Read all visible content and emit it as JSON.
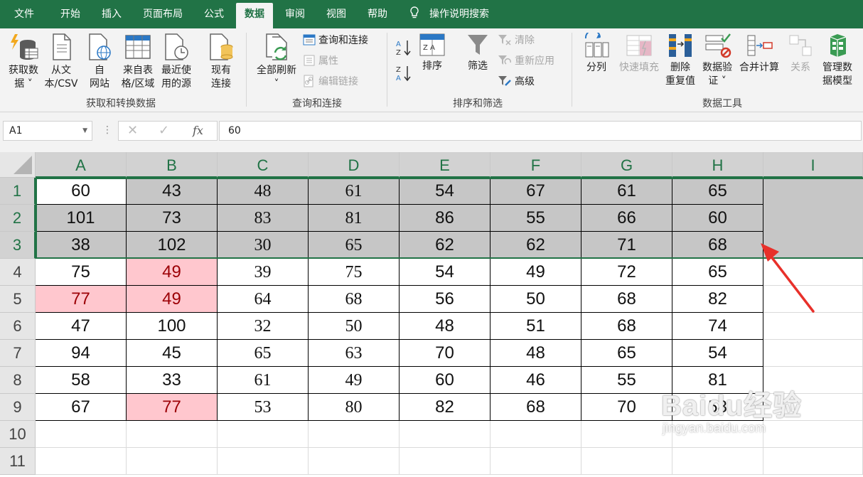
{
  "tabs": [
    {
      "label": "文件",
      "active": false
    },
    {
      "label": "开始",
      "active": false
    },
    {
      "label": "插入",
      "active": false
    },
    {
      "label": "页面布局",
      "active": false
    },
    {
      "label": "公式",
      "active": false
    },
    {
      "label": "数据",
      "active": true
    },
    {
      "label": "审阅",
      "active": false
    },
    {
      "label": "视图",
      "active": false
    },
    {
      "label": "帮助",
      "active": false
    }
  ],
  "tell_me": "操作说明搜索",
  "ribbon": {
    "get_transform": {
      "group_label": "获取和转换数据",
      "get_data": [
        "获取数",
        "据 ˅"
      ],
      "from_text": [
        "从文",
        "本/CSV"
      ],
      "from_web": [
        "自",
        "网站"
      ],
      "from_table": [
        "来自表",
        "格/区域"
      ],
      "recent_sources": [
        "最近使",
        "用的源"
      ],
      "existing_connections": [
        "现有",
        "连接"
      ]
    },
    "queries": {
      "group_label": "查询和连接",
      "refresh_all": [
        "全部刷新",
        "˅"
      ],
      "queries_connections": "查询和连接",
      "properties": "属性",
      "edit_links": "编辑链接"
    },
    "sort_filter": {
      "group_label": "排序和筛选",
      "sort": "排序",
      "filter": "筛选",
      "clear": "清除",
      "reapply": "重新应用",
      "advanced": "高级"
    },
    "data_tools": {
      "group_label": "数据工具",
      "text_to_columns": "分列",
      "flash_fill": "快速填充",
      "remove_duplicates": [
        "删除",
        "重复值"
      ],
      "data_validation": [
        "数据验",
        "证 ˅"
      ],
      "consolidate": "合并计算",
      "relationships": "关系",
      "manage_data_model": [
        "管理数",
        "据模型"
      ]
    }
  },
  "formula_bar": {
    "name_box": "A1",
    "value": "60",
    "fx": "fx"
  },
  "columns": [
    "A",
    "B",
    "C",
    "D",
    "E",
    "F",
    "G",
    "H",
    "I"
  ],
  "rows": [
    "1",
    "2",
    "3",
    "4",
    "5",
    "6",
    "7",
    "8",
    "9",
    "10",
    "11"
  ],
  "cells": [
    [
      "60",
      "43",
      "48",
      "61",
      "54",
      "67",
      "61",
      "65"
    ],
    [
      "101",
      "73",
      "83",
      "81",
      "86",
      "55",
      "66",
      "60"
    ],
    [
      "38",
      "102",
      "30",
      "65",
      "62",
      "62",
      "71",
      "68"
    ],
    [
      "75",
      "49",
      "39",
      "75",
      "54",
      "49",
      "72",
      "65"
    ],
    [
      "77",
      "49",
      "64",
      "68",
      "56",
      "50",
      "68",
      "82"
    ],
    [
      "47",
      "100",
      "32",
      "50",
      "48",
      "51",
      "68",
      "74"
    ],
    [
      "94",
      "45",
      "65",
      "63",
      "70",
      "48",
      "65",
      "54"
    ],
    [
      "58",
      "33",
      "61",
      "49",
      "60",
      "46",
      "55",
      "81"
    ],
    [
      "67",
      "77",
      "53",
      "80",
      "82",
      "68",
      "70",
      "58"
    ]
  ],
  "highlighted_cells": [
    "B4",
    "A5",
    "B5",
    "B9"
  ],
  "selection": "1:3",
  "colors": {
    "excel_green": "#217346",
    "selection_gray": "#c6c6c6",
    "highlight_fill": "#ffc7ce",
    "highlight_text": "#9c0006",
    "arrow_red": "#e8302a"
  },
  "watermark": {
    "line1": "Baidu经验",
    "line2": "jingyan.baidu.com"
  }
}
